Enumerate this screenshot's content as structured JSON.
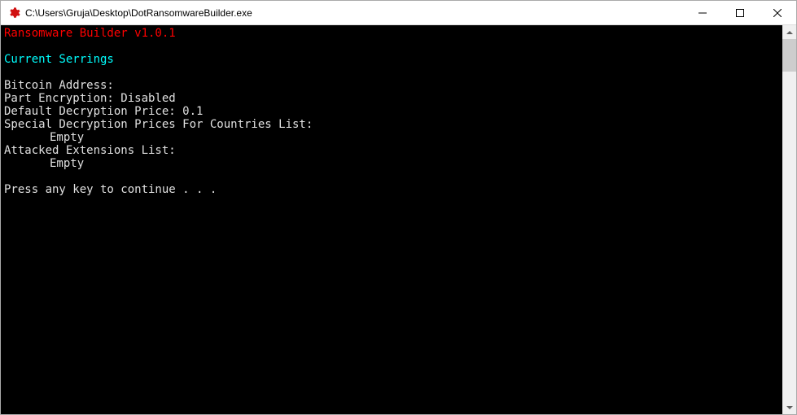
{
  "window": {
    "title": "C:\\Users\\Gruja\\Desktop\\DotRansomwareBuilder.exe"
  },
  "console": {
    "header": "Ransomware Builder v1.0.1",
    "section_title": "Current Serrings",
    "lines": {
      "bitcoin": "Bitcoin Address:",
      "part_encryption": "Part Encryption: Disabled",
      "default_price": "Default Decryption Price: 0.1",
      "special_prices": "Special Decryption Prices For Countries List:",
      "special_prices_value": "Empty",
      "attacked_ext": "Attacked Extensions List:",
      "attacked_ext_value": "Empty",
      "prompt": "Press any key to continue . . ."
    }
  }
}
